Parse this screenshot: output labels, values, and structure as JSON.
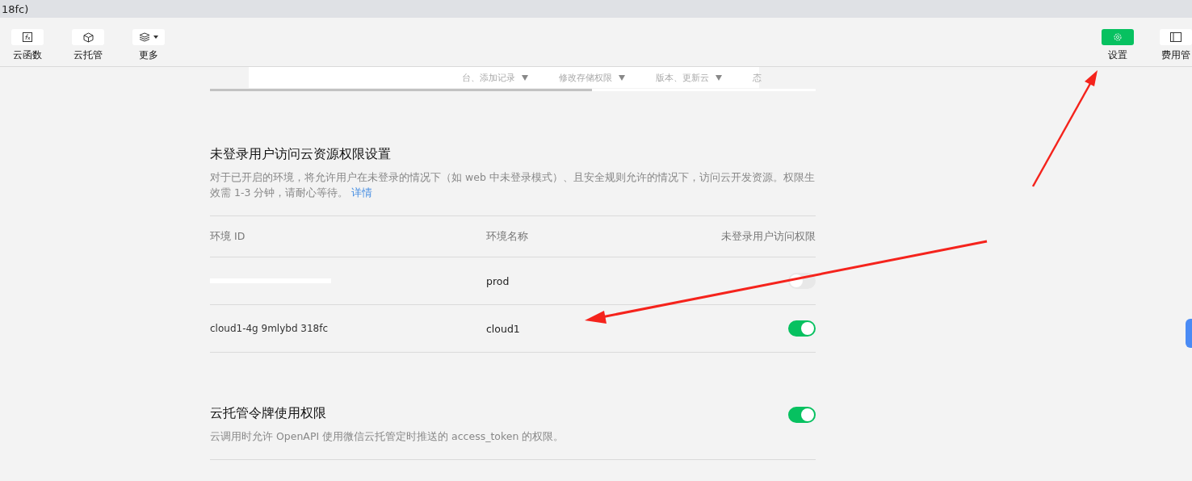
{
  "window": {
    "title": "18fc)"
  },
  "toolbar": {
    "left": [
      {
        "kind": "function",
        "label": "云函数"
      },
      {
        "kind": "box",
        "label": "云托管"
      },
      {
        "kind": "layers",
        "label": "更多"
      }
    ],
    "right": [
      {
        "kind": "gear",
        "label": "设置",
        "selected": true
      },
      {
        "kind": "panel",
        "label": "费用管",
        "selected": false
      }
    ]
  },
  "clipped_table": {
    "columns": [
      "台、添加记录",
      "修改存储权限",
      "版本、更新云",
      "态"
    ]
  },
  "guest_access": {
    "title": "未登录用户访问云资源权限设置",
    "description": "对于已开启的环境，将允许用户在未登录的情况下（如 web 中未登录模式）、且安全规则允许的情况下，访问云开发资源。权限生效需 1-3 分钟，请耐心等待。",
    "link": "详情",
    "columns": [
      "环境 ID",
      "环境名称",
      "未登录用户访问权限"
    ],
    "rows": [
      {
        "env_id": "",
        "name": "prod",
        "on": false
      },
      {
        "env_id": "cloud1-4g  9mlybd  318fc",
        "name": "cloud1",
        "on": true
      }
    ]
  },
  "token_access": {
    "title": "云托管令牌使用权限",
    "description": "云调用时允许 OpenAPI 使用微信云托管定时推送的 access_token 的权限。",
    "on": true
  }
}
